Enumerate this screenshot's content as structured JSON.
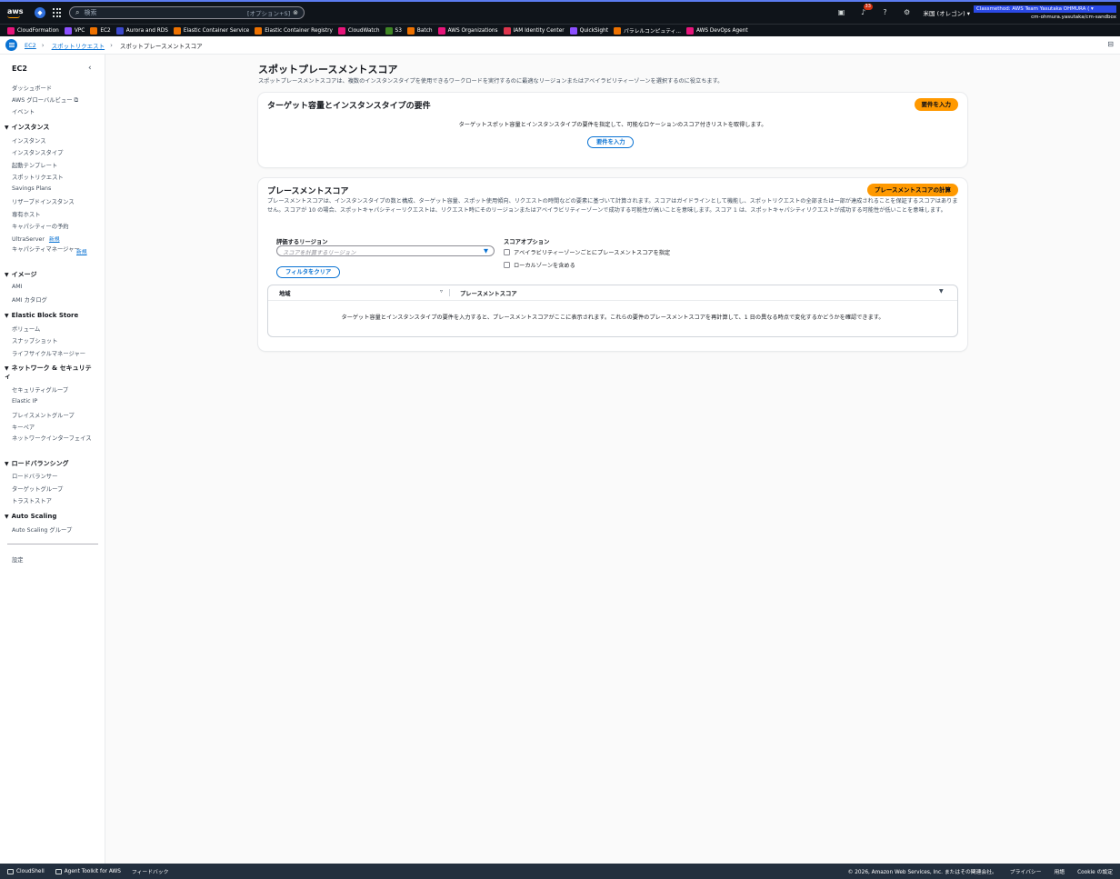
{
  "topbar": {
    "logo": "aws",
    "search_placeholder": "検索",
    "search_shortcut": "[オプション+S]",
    "notification_count": "33",
    "region": "米国 (オレゴン) ▾",
    "account_role": "Classmethod: AWS Team Yasutaka OHMURA ( ▾",
    "account_name": "cm-ohmura.yasutaka/cm-sandbox"
  },
  "favorites": [
    {
      "label": "CloudFormation",
      "color": "#e7157b"
    },
    {
      "label": "VPC",
      "color": "#8c4fff"
    },
    {
      "label": "EC2",
      "color": "#ed7100"
    },
    {
      "label": "Aurora and RDS",
      "color": "#3b48cc"
    },
    {
      "label": "Elastic Container Service",
      "color": "#ed7100"
    },
    {
      "label": "Elastic Container Registry",
      "color": "#ed7100"
    },
    {
      "label": "CloudWatch",
      "color": "#e7157b"
    },
    {
      "label": "S3",
      "color": "#3f8624"
    },
    {
      "label": "Batch",
      "color": "#ed7100"
    },
    {
      "label": "AWS Organizations",
      "color": "#e7157b"
    },
    {
      "label": "IAM Identity Center",
      "color": "#dd344c"
    },
    {
      "label": "QuickSight",
      "color": "#8c4fff"
    },
    {
      "label": "パラレルコンピュティ...",
      "color": "#ed7100"
    },
    {
      "label": "AWS DevOps Agent",
      "color": "#e7157b"
    }
  ],
  "breadcrumb": {
    "items": [
      "EC2",
      "スポットリクエスト",
      "スポットプレースメントスコア"
    ]
  },
  "sidebar": {
    "title": "EC2",
    "top_links": [
      "ダッシュボード",
      "AWS グローバルビュー",
      "イベント"
    ],
    "sections": [
      {
        "title": "インスタンス",
        "items": [
          "インスタンス",
          "インスタンスタイプ",
          "起動テンプレート",
          "スポットリクエスト",
          "Savings Plans",
          "リザーブドインスタンス",
          "専有ホスト",
          "キャパシティーの予約",
          "UltraServer",
          "キャパシティマネージャー"
        ]
      },
      {
        "title": "イメージ",
        "items": [
          "AMI",
          "AMI カタログ"
        ]
      },
      {
        "title": "Elastic Block Store",
        "items": [
          "ボリューム",
          "スナップショット",
          "ライフサイクルマネージャー"
        ]
      },
      {
        "title": "ネットワーク & セキュリティ",
        "items": [
          "セキュリティグループ",
          "Elastic IP",
          "プレイスメントグループ",
          "キーペア",
          "ネットワークインターフェイス"
        ]
      },
      {
        "title": "ロードバランシング",
        "items": [
          "ロードバランサー",
          "ターゲットグループ",
          "トラストストア"
        ]
      },
      {
        "title": "Auto Scaling",
        "items": [
          "Auto Scaling グループ"
        ]
      }
    ],
    "new_badge": "新規",
    "settings": "設定"
  },
  "main": {
    "title": "スポットプレースメントスコア",
    "description": "スポットプレースメントスコアは、複数のインスタンスタイプを使用できるワークロードを実行するのに最適なリージョンまたはアベイラビリティーゾーンを選択するのに役立ちます。",
    "requirements": {
      "heading": "ターゲット容量とインスタンスタイプの要件",
      "button": "要件を入力",
      "hint": "ターゲットスポット容量とインスタンスタイプの要件を指定して、可能なロケーションのスコア付きリストを取得します。",
      "center_button": "要件を入力"
    },
    "placement": {
      "heading": "プレースメントスコア",
      "calc_button": "プレースメントスコアの計算",
      "description": "プレースメントスコアは、インスタンスタイプの数と構成、ターゲット容量、スポット使用傾向、リクエストの時間などの要素に基づいて計算されます。スコアはガイドラインとして機能し、スポットリクエストの全部または一部が達成されることを保証するスコアはありません。スコアが 10 の場合、スポットキャパシティーリクエストは、リクエスト時にそのリージョンまたはアベイラビリティーゾーンで成功する可能性が高いことを意味します。スコア 1 は、スポットキャパシティリクエストが成功する可能性が低いことを意味します。",
      "region_label": "評価するリージョン",
      "region_placeholder": "スコアを計算するリージョン",
      "options_label": "スコアオプション",
      "option_az": "アベイラビリティーゾーンごとにプレースメントスコアを指定",
      "option_local": "ローカルゾーンを含める",
      "clear_button": "フィルタをクリア",
      "table": {
        "col_region": "地域",
        "col_score": "プレースメントスコア",
        "empty": "ターゲット容量とインスタンスタイプの要件を入力すると、プレースメントスコアがここに表示されます。これらの要件のプレースメントスコアを再計算して、1 日の異なる時点で変化するかどうかを確認できます。"
      }
    }
  },
  "footer": {
    "cloudshell": "CloudShell",
    "agent_toolkit": "Agent Toolkit for AWS",
    "feedback": "フィードバック",
    "copyright": "© 2026, Amazon Web Services, Inc. またはその関連会社。",
    "privacy": "プライバシー",
    "terms": "用語",
    "cookie": "Cookie の設定"
  }
}
